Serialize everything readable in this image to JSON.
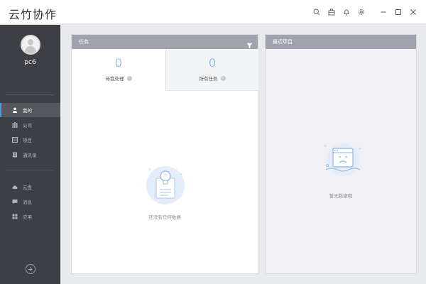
{
  "app": {
    "title": "云竹协作"
  },
  "user": {
    "name": "pc6"
  },
  "sidebar": {
    "items": [
      {
        "label": "我的",
        "icon": "user-icon"
      },
      {
        "label": "公司",
        "icon": "company-icon"
      },
      {
        "label": "项目",
        "icon": "project-icon"
      },
      {
        "label": "通讯录",
        "icon": "contacts-icon"
      },
      {
        "label": "云盘",
        "icon": "cloud-icon"
      },
      {
        "label": "消息",
        "icon": "message-icon"
      },
      {
        "label": "应用",
        "icon": "apps-icon"
      }
    ],
    "active_index": 0
  },
  "tasks": {
    "title": "任务",
    "tabs": [
      {
        "count": "0",
        "label": "待我处理"
      },
      {
        "count": "0",
        "label": "所有任务"
      }
    ],
    "empty_text": "还没有任何数据"
  },
  "recent": {
    "title": "最近项目",
    "empty_text": "暂无数据哦"
  },
  "colors": {
    "accent": "#4a9de0",
    "sidebar_bg": "#3e3f44",
    "panel_header": "#9ea3ad"
  }
}
